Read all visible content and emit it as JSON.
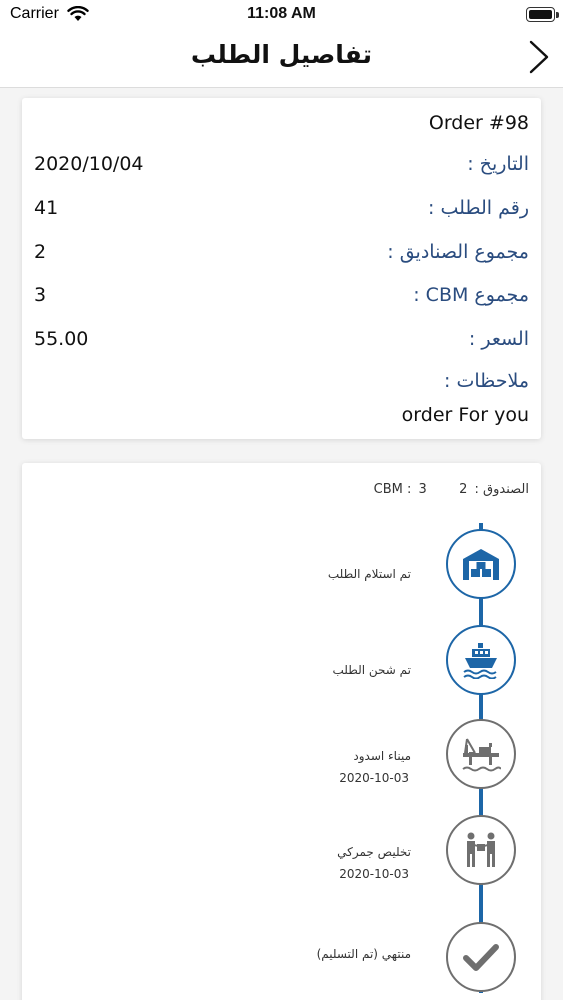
{
  "status_bar": {
    "carrier": "Carrier",
    "time": "11:08 AM"
  },
  "nav": {
    "title": "تفاصيل الطلب"
  },
  "order": {
    "number": "Order #98",
    "rows": [
      {
        "label": "التاريخ :",
        "value": "2020/10/04"
      },
      {
        "label": "رقم الطلب :",
        "value": "41"
      },
      {
        "label": "مجموع الصناديق :",
        "value": "2"
      },
      {
        "label": "مجموع CBM :",
        "value": "3"
      },
      {
        "label": "السعر :",
        "value": "55.00"
      },
      {
        "label": "ملاحظات :",
        "value": ""
      }
    ],
    "notes": "order For you"
  },
  "box": {
    "box_label": "الصندوق :",
    "box_value": "2",
    "cbm_label": "CBM :",
    "cbm_value": "3"
  },
  "timeline": {
    "accent_color": "#1d66a7",
    "inactive_color": "#6f6f6f",
    "steps": [
      {
        "label": "تم استلام الطلب",
        "date": "",
        "icon": "warehouse-icon",
        "active": true
      },
      {
        "label": "تم شحن الطلب",
        "date": "",
        "icon": "ship-icon",
        "active": true
      },
      {
        "label": "ميناء اسدود",
        "date": "2020-10-03",
        "icon": "port-crane-icon",
        "active": false
      },
      {
        "label": "تخليص جمركي",
        "date": "2020-10-03",
        "icon": "customs-handover-icon",
        "active": false
      },
      {
        "label": "منتهي (تم التسليم)",
        "date": "",
        "icon": "check-icon",
        "active": false
      }
    ]
  }
}
